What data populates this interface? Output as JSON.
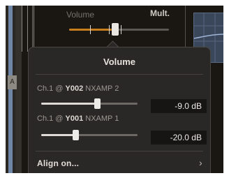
{
  "header": {
    "volume_label": "Volume",
    "mult_label": "Mult."
  },
  "side_tab": {
    "label": "A"
  },
  "popover": {
    "title": "Volume",
    "channels": [
      {
        "prefix": "Ch.1 @ ",
        "id": "Y002",
        "name": " NXAMP 2",
        "value": "-9.0 dB",
        "level": 0.58
      },
      {
        "prefix": "Ch.1 @ ",
        "id": "Y001",
        "name": " NXAMP 1",
        "value": "-20.0 dB",
        "level": 0.36
      }
    ],
    "align_label": "Align on...",
    "align_chevron": "›"
  },
  "colors": {
    "accent": "#c8801f",
    "popover_bg": "#2a2826",
    "app_bg": "#1a1713"
  },
  "icons": [
    "chevron-right-icon"
  ]
}
